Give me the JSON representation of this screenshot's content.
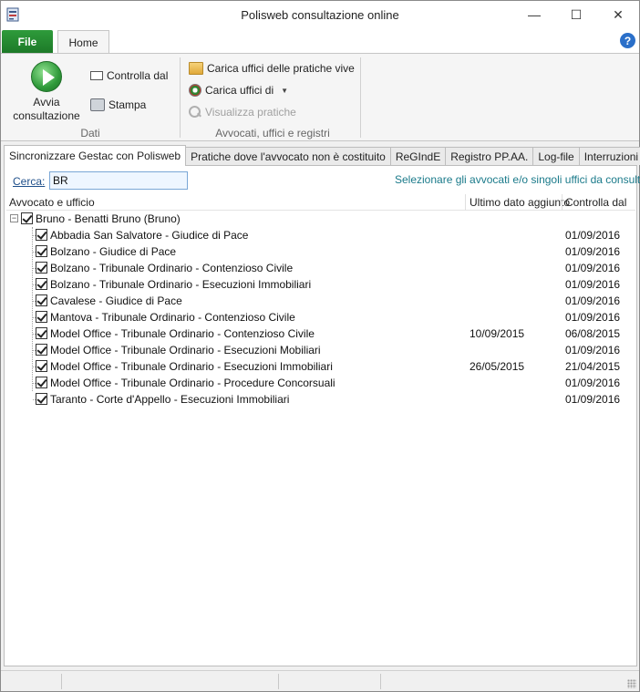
{
  "window": {
    "title": "Polisweb consultazione online",
    "minimize_glyph": "—",
    "maximize_glyph": "☐",
    "close_glyph": "✕"
  },
  "ribbon": {
    "file_tab": "File",
    "home_tab": "Home",
    "help_glyph": "?",
    "groups": {
      "dati": {
        "label": "Dati",
        "avvia": "Avvia consultazione",
        "controlla": "Controlla dal",
        "stampa": "Stampa"
      },
      "avvocati": {
        "label": "Avvocati, uffici e registri",
        "carica_vive": "Carica uffici delle pratiche vive",
        "carica_di": "Carica uffici di",
        "visualizza": "Visualizza pratiche"
      }
    }
  },
  "tabs": [
    {
      "label": "Sincronizzare Gestac con Polisweb",
      "active": true
    },
    {
      "label": "Pratiche dove l'avvocato non è costituito",
      "active": false
    },
    {
      "label": "ReGIndE",
      "active": false
    },
    {
      "label": "Registro PP.AA.",
      "active": false
    },
    {
      "label": "Log-file",
      "active": false
    },
    {
      "label": "Interruzioni",
      "active": false
    }
  ],
  "search": {
    "label": "Cerca:",
    "value": "BR",
    "hint": "Selezionare gli avvocati e/o singoli uffici da consultare"
  },
  "table": {
    "headers": {
      "ufficio": "Avvocato e ufficio",
      "ultimo": "Ultimo dato aggiunto",
      "controlla": "Controlla dal"
    },
    "parent": {
      "expander": "−",
      "label": "Bruno - Benatti Bruno (Bruno)"
    },
    "rows": [
      {
        "label": "Abbadia San Salvatore - Giudice di Pace",
        "ultimo": "",
        "controlla": "01/09/2016"
      },
      {
        "label": "Bolzano - Giudice di Pace",
        "ultimo": "",
        "controlla": "01/09/2016"
      },
      {
        "label": "Bolzano - Tribunale Ordinario - Contenzioso Civile",
        "ultimo": "",
        "controlla": "01/09/2016"
      },
      {
        "label": "Bolzano - Tribunale Ordinario - Esecuzioni Immobiliari",
        "ultimo": "",
        "controlla": "01/09/2016"
      },
      {
        "label": "Cavalese - Giudice di Pace",
        "ultimo": "",
        "controlla": "01/09/2016"
      },
      {
        "label": "Mantova - Tribunale Ordinario - Contenzioso Civile",
        "ultimo": "",
        "controlla": "01/09/2016"
      },
      {
        "label": "Model Office - Tribunale Ordinario - Contenzioso Civile",
        "ultimo": "10/09/2015",
        "controlla": "06/08/2015"
      },
      {
        "label": "Model Office - Tribunale Ordinario - Esecuzioni Mobiliari",
        "ultimo": "",
        "controlla": "01/09/2016"
      },
      {
        "label": "Model Office - Tribunale Ordinario - Esecuzioni Immobiliari",
        "ultimo": "26/05/2015",
        "controlla": "21/04/2015"
      },
      {
        "label": "Model Office - Tribunale Ordinario - Procedure Concorsuali",
        "ultimo": "",
        "controlla": "01/09/2016"
      },
      {
        "label": "Taranto - Corte d'Appello - Esecuzioni Immobiliari",
        "ultimo": "",
        "controlla": "01/09/2016"
      }
    ]
  },
  "colors": {
    "file_tab": "#2e9b3b",
    "hint_text": "#1a7a8a",
    "link_text": "#1f4f8a",
    "help": "#2a6fc9"
  },
  "icons": {
    "app": "app-icon",
    "avvia": "play-icon",
    "controlla": "calendar-icon",
    "stampa": "printer-icon",
    "carica_vive": "folder-open-icon",
    "carica_di": "emblem-icon",
    "visualizza": "search-icon"
  }
}
